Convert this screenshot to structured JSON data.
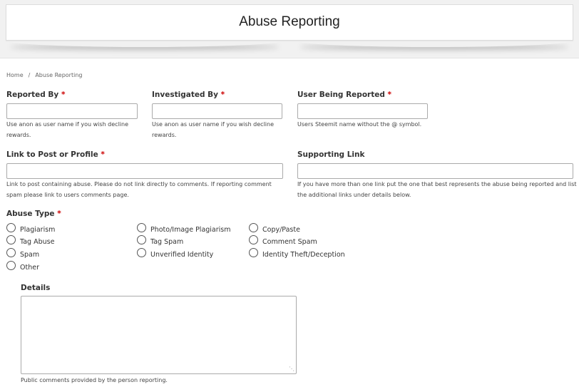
{
  "header": {
    "title": "Abuse Reporting"
  },
  "breadcrumb": {
    "home": "Home",
    "separator": "/",
    "current": "Abuse Reporting"
  },
  "required_mark": "*",
  "fields": {
    "reported_by": {
      "label": "Reported By",
      "value": "",
      "help": "Use anon as user name if you wish decline rewards."
    },
    "investigated_by": {
      "label": "Investigated By",
      "value": "",
      "help": "Use anon as user name if you wish decline rewards."
    },
    "user_reported": {
      "label": "User Being Reported",
      "value": "",
      "help": "Users Steemit name without the @ symbol."
    },
    "link_post": {
      "label": "Link to Post or Profile",
      "value": "",
      "help": "Link to post containing abuse. Please do not link directly to comments. If reporting comment spam please link to users comments page."
    },
    "supporting_link": {
      "label": "Supporting Link",
      "value": "",
      "help": "If you have more than one link put the one that best represents the abuse being reported and list the additional links under details below."
    }
  },
  "abuse_type": {
    "label": "Abuse Type",
    "options": [
      "Plagiarism",
      "Tag Abuse",
      "Spam",
      "Other",
      "Photo/Image Plagiarism",
      "Tag Spam",
      "Unverified Identity",
      "Copy/Paste",
      "Comment Spam",
      "Identity Theft/Deception"
    ]
  },
  "details": {
    "label": "Details",
    "value": "",
    "help": "Public comments provided by the person reporting."
  }
}
